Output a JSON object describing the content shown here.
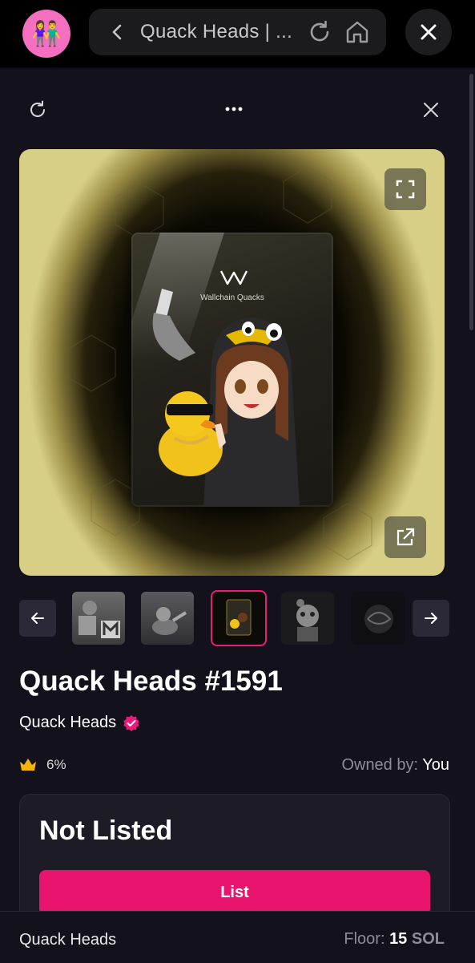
{
  "browser": {
    "avatar_emoji": "👫",
    "page_title": "Quack Heads | ...",
    "icons": {
      "back": "chevron-left-icon",
      "reload": "reload-icon",
      "home": "home-icon",
      "close": "close-icon"
    }
  },
  "panel": {
    "icons": {
      "refresh": "refresh-icon",
      "more": "more-icon",
      "close": "close-icon"
    }
  },
  "media": {
    "pack_brand": "Wallchain Quacks",
    "icons": {
      "fullscreen": "fullscreen-icon",
      "open_external": "external-link-icon"
    }
  },
  "gallery": {
    "selected_index": 2,
    "thumbnails": [
      "thumb-robot-m",
      "thumb-figure-grey",
      "thumb-quack-pack",
      "thumb-skull-character",
      "thumb-dark-orb"
    ]
  },
  "nft": {
    "name": "Quack Heads #1591",
    "collection": "Quack Heads",
    "verified": true,
    "rarity": "6%",
    "owned_label": "Owned by:",
    "owner": "You"
  },
  "listing": {
    "status": "Not Listed",
    "button_label": "List"
  },
  "footer": {
    "collection": "Quack Heads",
    "floor_label": "Floor:",
    "floor_value": "15",
    "floor_unit": "SOL"
  },
  "colors": {
    "accent": "#e8146e",
    "panel": "#13111b",
    "card": "#1d1b26",
    "gold": "#f5b40a"
  }
}
